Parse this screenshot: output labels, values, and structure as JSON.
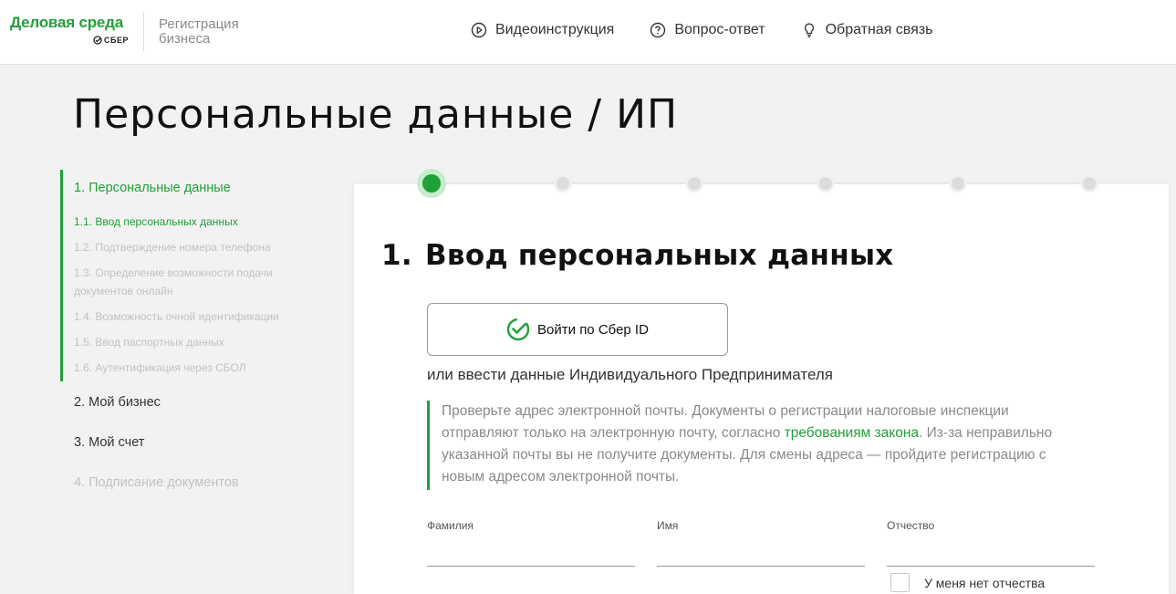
{
  "header": {
    "logo_title": "Деловая среда",
    "logo_brand": "СБЕР",
    "logo_sub": "Регистрация бизнеса",
    "nav": [
      {
        "label": "Видеоинструкция",
        "icon": "play-circle-icon"
      },
      {
        "label": "Вопрос-ответ",
        "icon": "question-circle-icon"
      },
      {
        "label": "Обратная связь",
        "icon": "lightbulb-icon"
      }
    ]
  },
  "page_title": "Персональные данные / ИП",
  "sidebar": {
    "section1": "1. Персональные данные",
    "subs": [
      "1.1. Ввод персональных данных",
      "1.2. Подтверждение номера телефона",
      "1.3. Определение возможности подачи документов онлайн",
      "1.4. Возможность очной идентификации",
      "1.5. Ввод паспортных данных",
      "1.6. Аутентификация через СБОЛ"
    ],
    "section2": "2. Мой бизнес",
    "section3": "3. Мой счет",
    "section4": "4. Подписание документов"
  },
  "stepper": {
    "total": 6,
    "active": 1
  },
  "main": {
    "section_num": "1.",
    "section_title": "Ввод персональных данных",
    "sber_id_button": "Войти по Сбер ID",
    "or_text": "или ввести данные Индивидуального Предпринимателя",
    "notice_part1": "Проверьте адрес электронной почты. Документы о регистрации налоговые инспекции отправляют только на электронную почту, согласно ",
    "notice_link": "требованиям закона",
    "notice_part2": ". Из-за неправильно указанной почты вы не получите документы. Для смены адреса — пройдите регистрацию с новым адресом электронной почты.",
    "fields": [
      {
        "label": "Фамилия",
        "value": ""
      },
      {
        "label": "Имя",
        "value": ""
      },
      {
        "label": "Отчество",
        "value": ""
      }
    ],
    "no_patronymic": "У меня нет отчества"
  },
  "colors": {
    "accent": "#21a038",
    "muted": "#c2c2c2"
  }
}
